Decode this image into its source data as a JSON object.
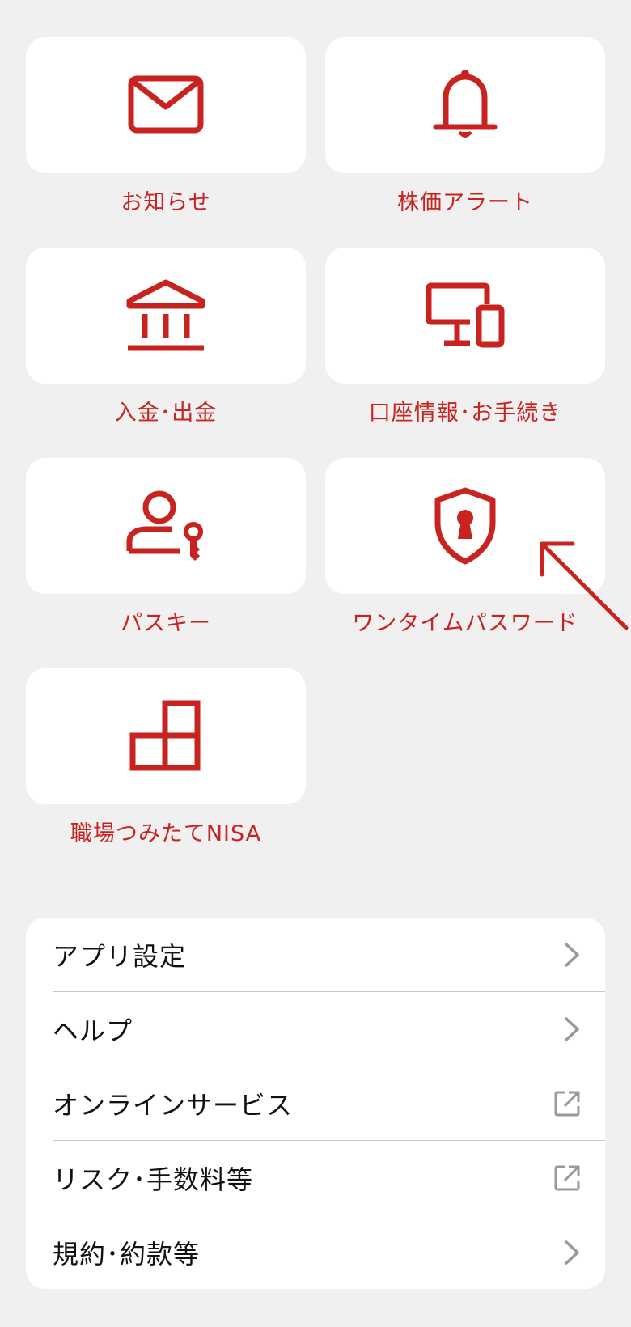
{
  "colors": {
    "accent": "#c8231f",
    "background": "#f0f0f0",
    "card": "#ffffff",
    "menu_text": "#111111",
    "chevron": "#999999"
  },
  "tiles": [
    {
      "label": "お知らせ",
      "icon": "mail-icon"
    },
    {
      "label": "株価アラート",
      "icon": "bell-icon"
    },
    {
      "label": "入金･出金",
      "icon": "bank-icon"
    },
    {
      "label": "口座情報･お手続き",
      "icon": "devices-icon"
    },
    {
      "label": "パスキー",
      "icon": "user-key-icon"
    },
    {
      "label": "ワンタイムパスワード",
      "icon": "shield-lock-icon"
    },
    {
      "label": "職場つみたてNISA",
      "icon": "blocks-icon"
    }
  ],
  "menu": [
    {
      "label": "アプリ設定",
      "trail": "chevron-right-icon"
    },
    {
      "label": "ヘルプ",
      "trail": "chevron-right-icon"
    },
    {
      "label": "オンラインサービス",
      "trail": "external-link-icon"
    },
    {
      "label": "リスク･手数料等",
      "trail": "external-link-icon"
    },
    {
      "label": "規約･約款等",
      "trail": "chevron-right-icon"
    }
  ]
}
